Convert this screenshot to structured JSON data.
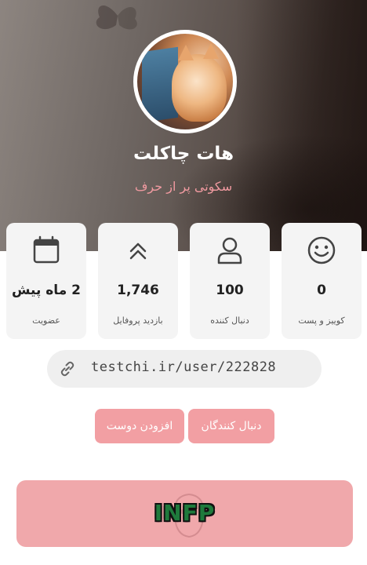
{
  "profile": {
    "name": "هات چاکلت",
    "bio": "سکوتی پر از حرف"
  },
  "stats": [
    {
      "value": "0",
      "label": "کوییز و پست",
      "icon": "smiley-icon"
    },
    {
      "value": "100",
      "label": "دنبال کننده",
      "icon": "user-icon"
    },
    {
      "value": "1,746",
      "label": "بازدید پروفایل",
      "icon": "chevrons-up-icon"
    },
    {
      "value": "2 ماه پیش",
      "label": "عضویت",
      "icon": "calendar-icon"
    }
  ],
  "profile_link": {
    "url": "testchi.ir/user/222828",
    "icon": "link-icon"
  },
  "buttons": {
    "followers": "دنبال کنندگان",
    "add_friend": "افزودن دوست"
  },
  "personality_type": "INFP",
  "colors": {
    "accent_pink": "#f29fa3",
    "bio_pink": "#f09aa0",
    "card_bg": "#f4f4f4",
    "type_text": "#1f7a3c"
  }
}
